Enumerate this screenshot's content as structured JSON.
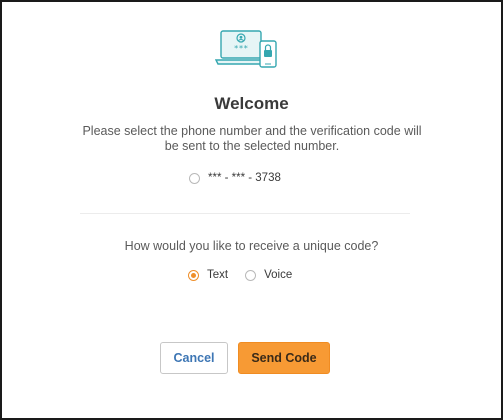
{
  "hero": {
    "icon": "laptop-phone-lock-icon",
    "masked_text": "***"
  },
  "title": "Welcome",
  "instructions": "Please select the phone number and the verification code will be sent to the selected number.",
  "phone_options": [
    {
      "label": "*** - *** - 3738",
      "selected": false
    }
  ],
  "question": "How would you like to receive a unique code?",
  "methods": [
    {
      "label": "Text",
      "selected": true
    },
    {
      "label": "Voice",
      "selected": false
    }
  ],
  "buttons": {
    "cancel": "Cancel",
    "send": "Send Code"
  },
  "colors": {
    "accent": "#f79a34",
    "link_blue": "#3d76b4",
    "icon_teal": "#35a7b0"
  }
}
